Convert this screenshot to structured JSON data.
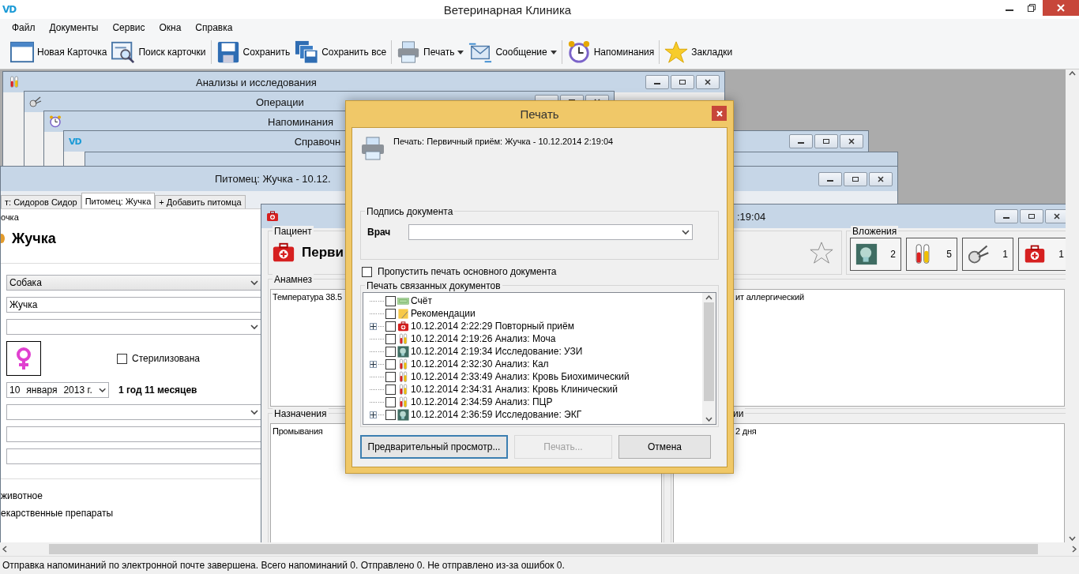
{
  "app": {
    "logo": "VD",
    "title": "Ветеринарная Клиника"
  },
  "menu": [
    "Файл",
    "Документы",
    "Сервис",
    "Окна",
    "Справка"
  ],
  "toolbar": [
    {
      "label": "Новая Карточка",
      "kind": "card",
      "dropdown": false
    },
    {
      "label": "Поиск карточки",
      "kind": "search",
      "dropdown": false
    },
    {
      "label": "Сохранить",
      "kind": "save",
      "dropdown": false
    },
    {
      "label": "Сохранить все",
      "kind": "save-all",
      "dropdown": false
    },
    {
      "label": "Печать",
      "kind": "print",
      "dropdown": true
    },
    {
      "label": "Сообщение",
      "kind": "message",
      "dropdown": true
    },
    {
      "label": "Напоминания",
      "kind": "alarm",
      "dropdown": false
    },
    {
      "label": "Закладки",
      "kind": "star",
      "dropdown": false
    }
  ],
  "windows": [
    {
      "title": "Анализы и исследования",
      "kind": "tubes"
    },
    {
      "title": "Операции",
      "kind": "scissors"
    },
    {
      "title": "Напоминания",
      "kind": "alarm"
    },
    {
      "title": "Справочн",
      "logo": "VD"
    }
  ],
  "pet_window": {
    "title": "Питомец: Жучка - 10.12.",
    "tabs": [
      {
        "label": "т: Сидоров Сидор",
        "selected": false
      },
      {
        "label": "Питомец: Жучка",
        "selected": true
      },
      {
        "label": "+ Добавить питомца",
        "selected": false
      }
    ],
    "group_label": "очка",
    "name": "Жучка",
    "species": "Собака",
    "nickname": "Жучка",
    "gender": {
      "kind": "female"
    },
    "sterilized": {
      "label": "Стерилизована",
      "checked": false
    },
    "birth_date": {
      "day": "10",
      "month": "января",
      "year": "2013 г."
    },
    "age": "1 год 11 месяцев",
    "options": [
      "животное",
      "екарственные препараты"
    ]
  },
  "visit_window": {
    "title": ":19:04",
    "patient_label": "Пациент",
    "heading": "Перви",
    "favorite": false,
    "attachments_label": "Вложения",
    "attachments": [
      {
        "kind": "scan",
        "count": "2"
      },
      {
        "kind": "tubes",
        "count": "5"
      },
      {
        "kind": "scissors",
        "count": "1"
      },
      {
        "kind": "medkit",
        "count": "1"
      }
    ],
    "panels": [
      {
        "label": "Анамнез",
        "text": "Температура 38.5"
      },
      {
        "text": "ит аллергический"
      },
      {
        "label": "Назначения",
        "text": "Промывания"
      },
      {
        "label": "ии",
        "text": "2 дня"
      }
    ]
  },
  "print_dialog": {
    "title": "Печать",
    "header": "Печать: Первичный приём: Жучка - 10.12.2014 2:19:04",
    "signature_label": "Подпись документа",
    "doctor_label": "Врач",
    "skip_main": {
      "label": "Пропустить печать основного документа",
      "checked": false
    },
    "related_label": "Печать связанных документов",
    "items": [
      {
        "text": "Счёт",
        "kind": "invoice",
        "expandable": false,
        "checked": false
      },
      {
        "text": "Рекомендации",
        "kind": "note",
        "expandable": false,
        "checked": false
      },
      {
        "text": "10.12.2014 2:22:29 Повторный приём",
        "kind": "medkit",
        "expandable": true,
        "checked": false
      },
      {
        "text": "10.12.2014 2:19:26 Анализ: Моча",
        "kind": "tubes",
        "expandable": false,
        "checked": false
      },
      {
        "text": "10.12.2014 2:19:34 Исследование: УЗИ",
        "kind": "scan",
        "expandable": false,
        "checked": false
      },
      {
        "text": "10.12.2014 2:32:30 Анализ: Кал",
        "kind": "tubes",
        "expandable": true,
        "checked": false
      },
      {
        "text": "10.12.2014 2:33:49 Анализ: Кровь Биохимический",
        "kind": "tubes",
        "expandable": false,
        "checked": false
      },
      {
        "text": "10.12.2014 2:34:31 Анализ: Кровь Клинический",
        "kind": "tubes",
        "expandable": false,
        "checked": false
      },
      {
        "text": "10.12.2014 2:34:59 Анализ: ПЦР",
        "kind": "tubes",
        "expandable": false,
        "checked": false
      },
      {
        "text": "10.12.2014 2:36:59 Исследование: ЭКГ",
        "kind": "scan",
        "expandable": true,
        "checked": false
      }
    ],
    "buttons": [
      {
        "label": "Предварительный просмотр...",
        "focused": true,
        "disabled": false
      },
      {
        "label": "Печать...",
        "focused": false,
        "disabled": true
      },
      {
        "label": "Отмена",
        "focused": false,
        "disabled": false
      }
    ]
  },
  "status": "Отправка напоминаний по электронной почте завершена. Всего напоминаний 0. Отправлено 0. Не отправлено из-за ошибок 0."
}
